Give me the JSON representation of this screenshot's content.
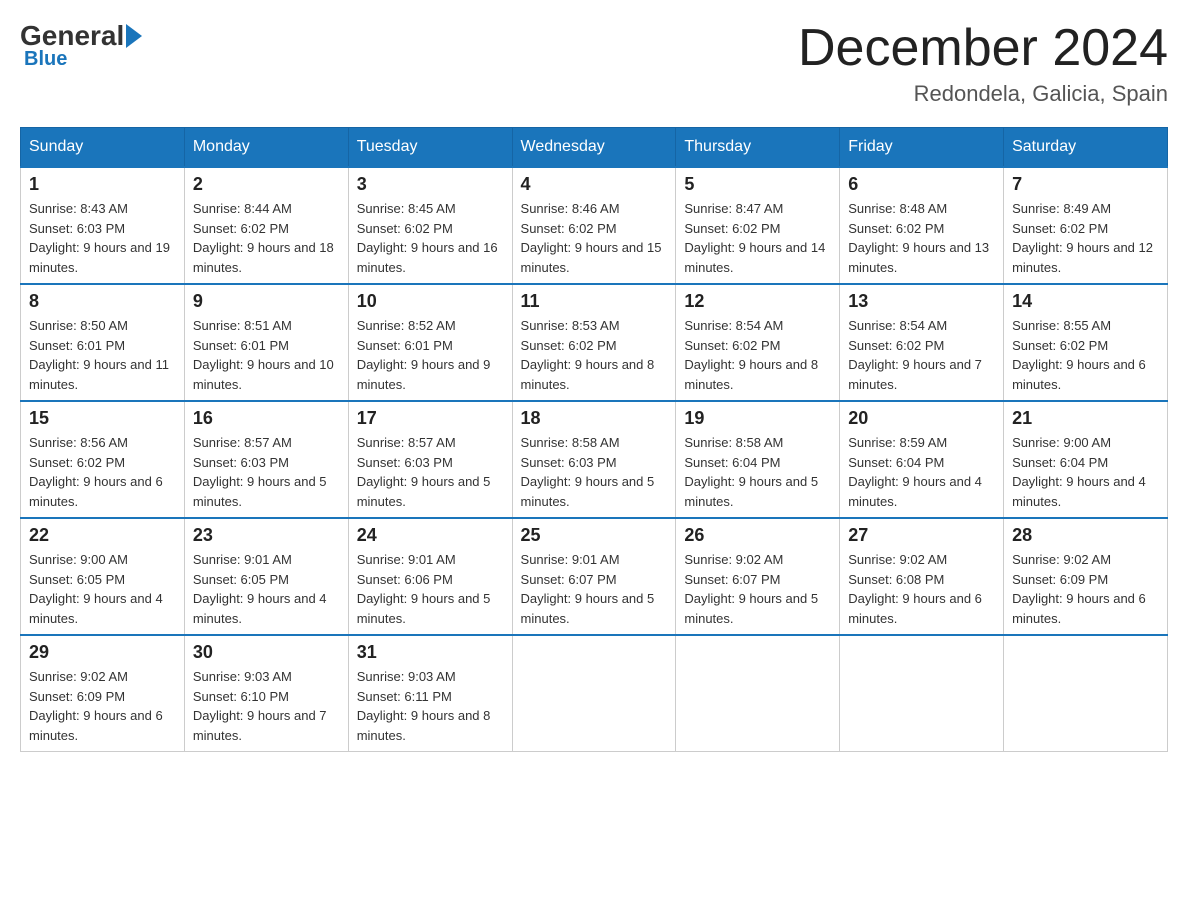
{
  "logo": {
    "general": "General",
    "blue": "Blue"
  },
  "header": {
    "title": "December 2024",
    "subtitle": "Redondela, Galicia, Spain"
  },
  "days_of_week": [
    "Sunday",
    "Monday",
    "Tuesday",
    "Wednesday",
    "Thursday",
    "Friday",
    "Saturday"
  ],
  "weeks": [
    [
      {
        "day": "1",
        "sunrise": "8:43 AM",
        "sunset": "6:03 PM",
        "daylight": "9 hours and 19 minutes."
      },
      {
        "day": "2",
        "sunrise": "8:44 AM",
        "sunset": "6:02 PM",
        "daylight": "9 hours and 18 minutes."
      },
      {
        "day": "3",
        "sunrise": "8:45 AM",
        "sunset": "6:02 PM",
        "daylight": "9 hours and 16 minutes."
      },
      {
        "day": "4",
        "sunrise": "8:46 AM",
        "sunset": "6:02 PM",
        "daylight": "9 hours and 15 minutes."
      },
      {
        "day": "5",
        "sunrise": "8:47 AM",
        "sunset": "6:02 PM",
        "daylight": "9 hours and 14 minutes."
      },
      {
        "day": "6",
        "sunrise": "8:48 AM",
        "sunset": "6:02 PM",
        "daylight": "9 hours and 13 minutes."
      },
      {
        "day": "7",
        "sunrise": "8:49 AM",
        "sunset": "6:02 PM",
        "daylight": "9 hours and 12 minutes."
      }
    ],
    [
      {
        "day": "8",
        "sunrise": "8:50 AM",
        "sunset": "6:01 PM",
        "daylight": "9 hours and 11 minutes."
      },
      {
        "day": "9",
        "sunrise": "8:51 AM",
        "sunset": "6:01 PM",
        "daylight": "9 hours and 10 minutes."
      },
      {
        "day": "10",
        "sunrise": "8:52 AM",
        "sunset": "6:01 PM",
        "daylight": "9 hours and 9 minutes."
      },
      {
        "day": "11",
        "sunrise": "8:53 AM",
        "sunset": "6:02 PM",
        "daylight": "9 hours and 8 minutes."
      },
      {
        "day": "12",
        "sunrise": "8:54 AM",
        "sunset": "6:02 PM",
        "daylight": "9 hours and 8 minutes."
      },
      {
        "day": "13",
        "sunrise": "8:54 AM",
        "sunset": "6:02 PM",
        "daylight": "9 hours and 7 minutes."
      },
      {
        "day": "14",
        "sunrise": "8:55 AM",
        "sunset": "6:02 PM",
        "daylight": "9 hours and 6 minutes."
      }
    ],
    [
      {
        "day": "15",
        "sunrise": "8:56 AM",
        "sunset": "6:02 PM",
        "daylight": "9 hours and 6 minutes."
      },
      {
        "day": "16",
        "sunrise": "8:57 AM",
        "sunset": "6:03 PM",
        "daylight": "9 hours and 5 minutes."
      },
      {
        "day": "17",
        "sunrise": "8:57 AM",
        "sunset": "6:03 PM",
        "daylight": "9 hours and 5 minutes."
      },
      {
        "day": "18",
        "sunrise": "8:58 AM",
        "sunset": "6:03 PM",
        "daylight": "9 hours and 5 minutes."
      },
      {
        "day": "19",
        "sunrise": "8:58 AM",
        "sunset": "6:04 PM",
        "daylight": "9 hours and 5 minutes."
      },
      {
        "day": "20",
        "sunrise": "8:59 AM",
        "sunset": "6:04 PM",
        "daylight": "9 hours and 4 minutes."
      },
      {
        "day": "21",
        "sunrise": "9:00 AM",
        "sunset": "6:04 PM",
        "daylight": "9 hours and 4 minutes."
      }
    ],
    [
      {
        "day": "22",
        "sunrise": "9:00 AM",
        "sunset": "6:05 PM",
        "daylight": "9 hours and 4 minutes."
      },
      {
        "day": "23",
        "sunrise": "9:01 AM",
        "sunset": "6:05 PM",
        "daylight": "9 hours and 4 minutes."
      },
      {
        "day": "24",
        "sunrise": "9:01 AM",
        "sunset": "6:06 PM",
        "daylight": "9 hours and 5 minutes."
      },
      {
        "day": "25",
        "sunrise": "9:01 AM",
        "sunset": "6:07 PM",
        "daylight": "9 hours and 5 minutes."
      },
      {
        "day": "26",
        "sunrise": "9:02 AM",
        "sunset": "6:07 PM",
        "daylight": "9 hours and 5 minutes."
      },
      {
        "day": "27",
        "sunrise": "9:02 AM",
        "sunset": "6:08 PM",
        "daylight": "9 hours and 6 minutes."
      },
      {
        "day": "28",
        "sunrise": "9:02 AM",
        "sunset": "6:09 PM",
        "daylight": "9 hours and 6 minutes."
      }
    ],
    [
      {
        "day": "29",
        "sunrise": "9:02 AM",
        "sunset": "6:09 PM",
        "daylight": "9 hours and 6 minutes."
      },
      {
        "day": "30",
        "sunrise": "9:03 AM",
        "sunset": "6:10 PM",
        "daylight": "9 hours and 7 minutes."
      },
      {
        "day": "31",
        "sunrise": "9:03 AM",
        "sunset": "6:11 PM",
        "daylight": "9 hours and 8 minutes."
      },
      null,
      null,
      null,
      null
    ]
  ]
}
